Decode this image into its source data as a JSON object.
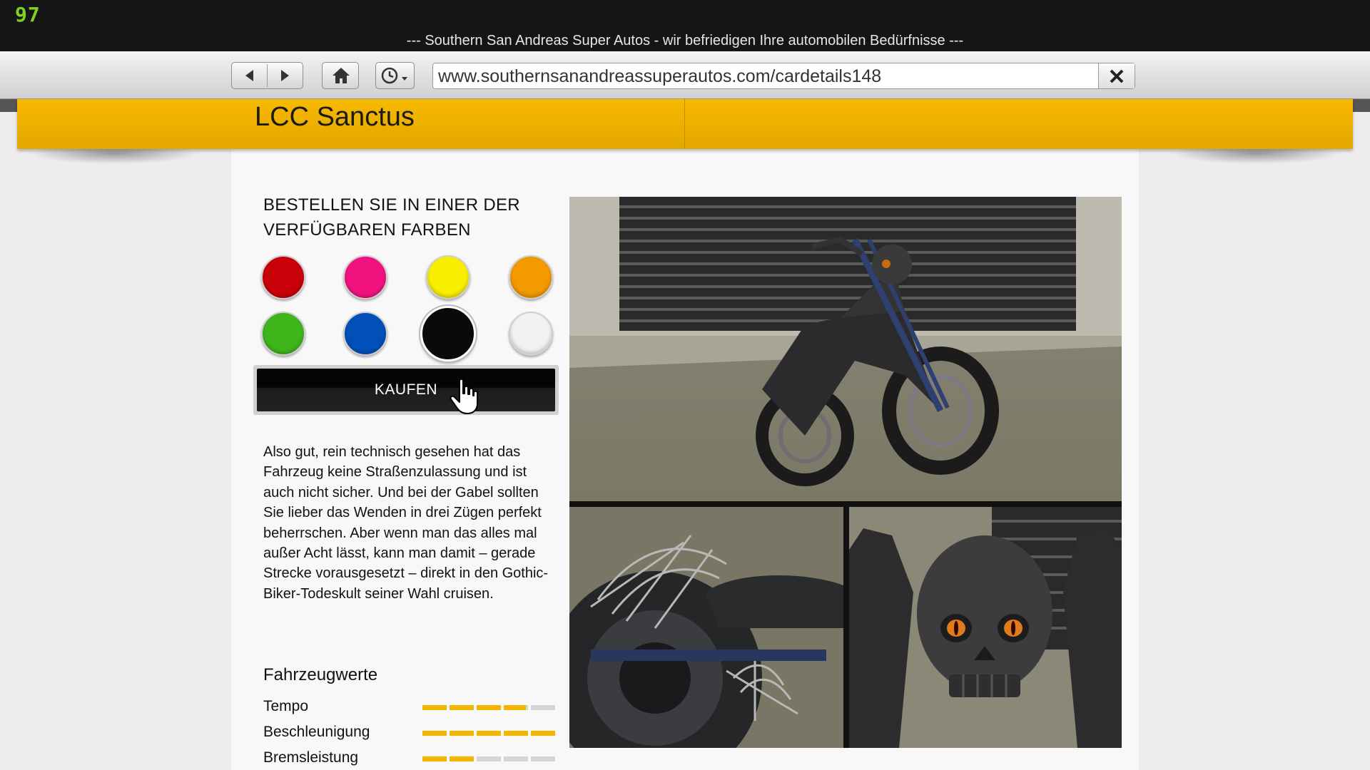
{
  "overlay": {
    "fps": "97"
  },
  "window": {
    "title": "--- Southern San Andreas Super Autos - wir befriedigen Ihre automobilen Bedürfnisse ---"
  },
  "browser": {
    "back_icon": "back-arrow-icon",
    "forward_icon": "forward-arrow-icon",
    "home_icon": "home-icon",
    "history_icon": "history-clock-icon",
    "url": "www.southernsanandreassuperautos.com/cardetails148",
    "close_icon": "close-icon"
  },
  "vehicle": {
    "name": "LCC Sanctus"
  },
  "order": {
    "heading_line1": "BESTELLEN SIE IN EINER DER",
    "heading_line2": "VERFÜGBAREN FARBEN",
    "colors": [
      {
        "name": "red",
        "hex": "#c8000a"
      },
      {
        "name": "pink",
        "hex": "#f0127f"
      },
      {
        "name": "yellow",
        "hex": "#f7ee00"
      },
      {
        "name": "orange",
        "hex": "#f29a00"
      },
      {
        "name": "green",
        "hex": "#3fb51c"
      },
      {
        "name": "blue",
        "hex": "#0050b8"
      },
      {
        "name": "black",
        "hex": "#0a0a0a",
        "selected": true
      },
      {
        "name": "white",
        "hex": "#f1f1f1"
      }
    ],
    "buy_label": "KAUFEN"
  },
  "description": "Also gut, rein technisch gesehen hat das Fahrzeug keine Straßenzulassung und ist auch nicht sicher. Und bei der Gabel sollten Sie lieber das Wenden in drei Zügen perfekt beherrschen. Aber wenn man das alles mal außer Acht lässt, kann man damit – gerade Strecke vorausgesetzt – direkt in den Gothic-Biker-Todeskult seiner Wahl cruisen.",
  "stats": {
    "heading": "Fahrzeugwerte",
    "items": [
      {
        "label": "Tempo",
        "value": 0.78
      },
      {
        "label": "Beschleunigung",
        "value": 1.0
      },
      {
        "label": "Bremsleistung",
        "value": 0.4
      }
    ]
  },
  "accent_color": "#f2b600"
}
